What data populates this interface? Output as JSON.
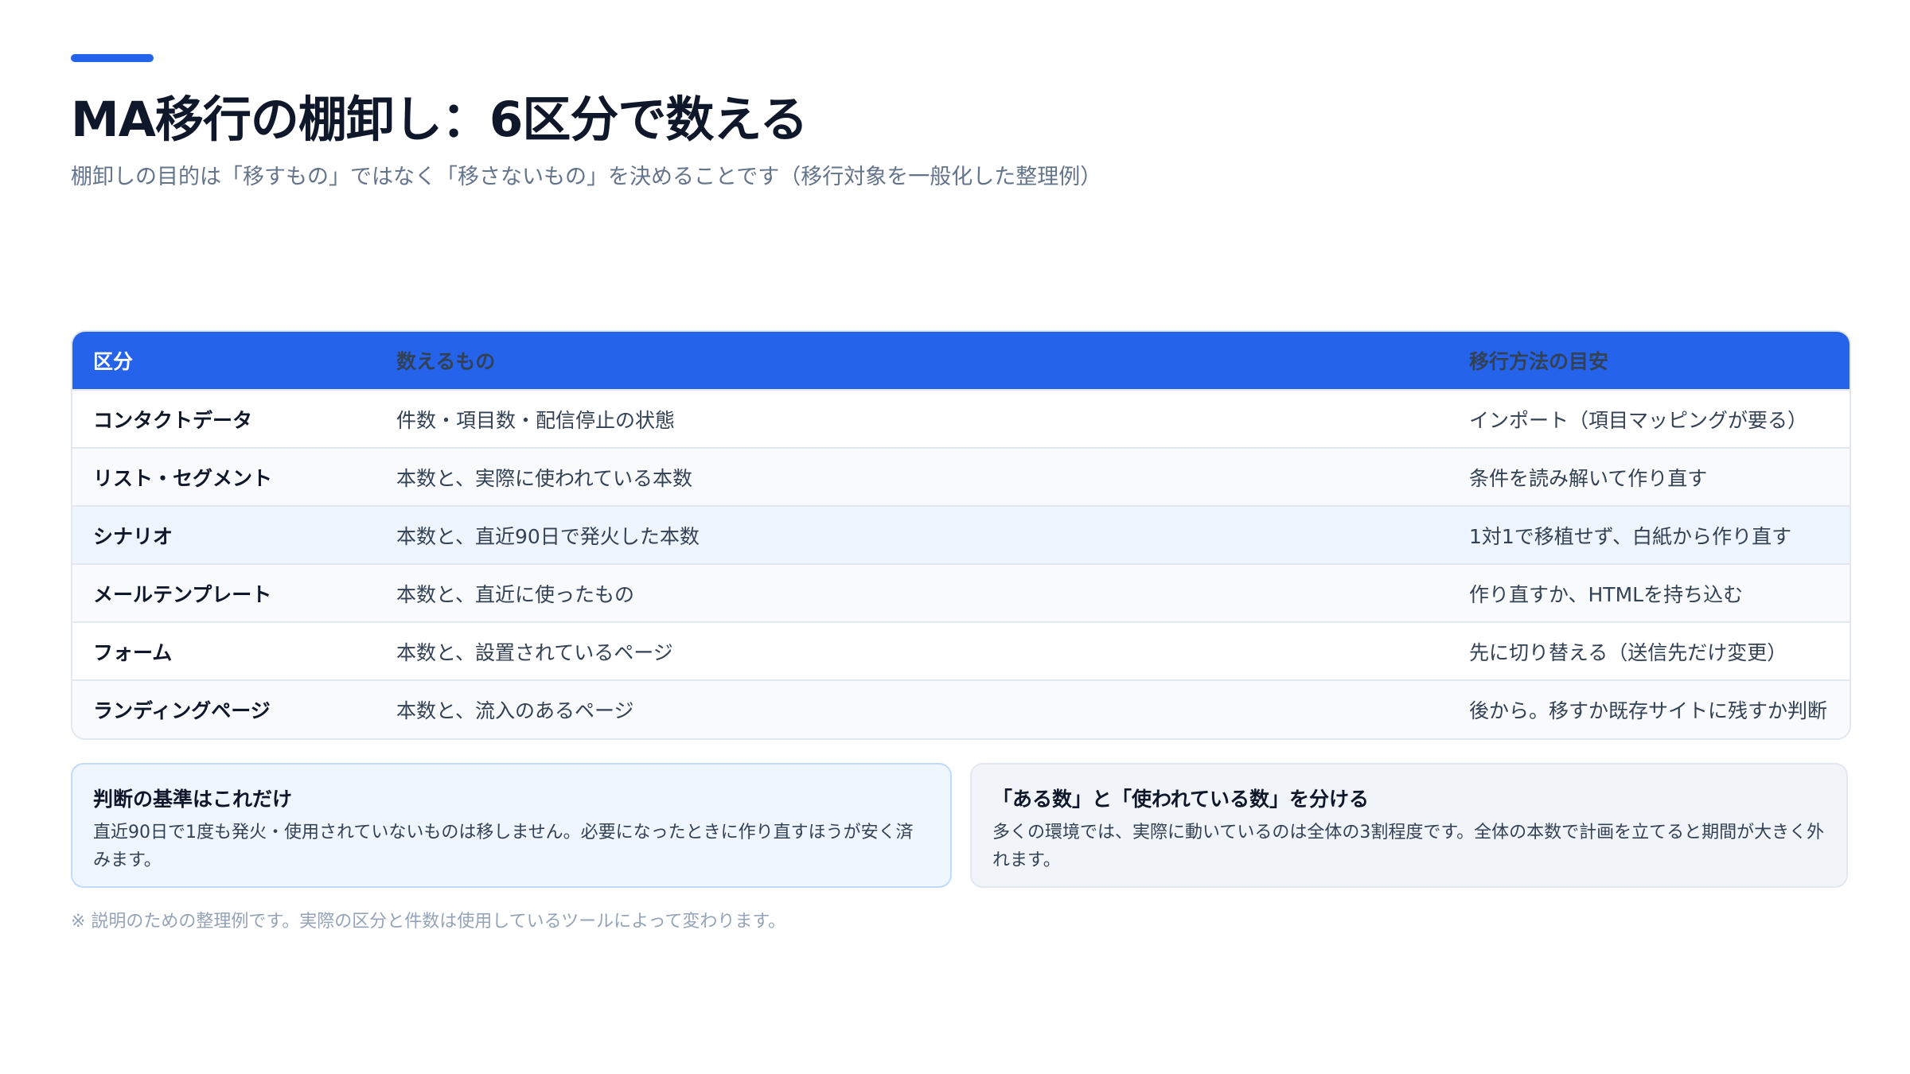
{
  "header": {
    "title": "MA移行の棚卸し：6区分で数える",
    "subtitle": "棚卸しの目的は「移すもの」ではなく「移さないもの」を決めることです（移行対象を一般化した整理例）"
  },
  "table": {
    "columns": [
      "区分",
      "数えるもの",
      "移行方法の目安"
    ],
    "rows": [
      {
        "category": "コンタクトデータ",
        "count": "件数・項目数・配信停止の状態",
        "method": "インポート（項目マッピングが要る）"
      },
      {
        "category": "リスト・セグメント",
        "count": "本数と、実際に使われている本数",
        "method": "条件を読み解いて作り直す"
      },
      {
        "category": "シナリオ",
        "count": "本数と、直近90日で発火した本数",
        "method": "1対1で移植せず、白紙から作り直す"
      },
      {
        "category": "メールテンプレート",
        "count": "本数と、直近に使ったもの",
        "method": "作り直すか、HTMLを持ち込む"
      },
      {
        "category": "フォーム",
        "count": "本数と、設置されているページ",
        "method": "先に切り替える（送信先だけ変更）"
      },
      {
        "category": "ランディングページ",
        "count": "本数と、流入のあるページ",
        "method": "後から。移すか既存サイトに残すか判断"
      }
    ]
  },
  "notes": [
    {
      "title": "判断の基準はこれだけ",
      "body": "直近90日で1度も発火・使用されていないものは移しません。必要になったときに作り直すほうが安く済みます。"
    },
    {
      "title": "「ある数」と「使われている数」を分ける",
      "body": "多くの環境では、実際に動いているのは全体の3割程度です。全体の本数で計画を立てると期間が大きく外れます。"
    }
  ],
  "footnote": "※ 説明のための整理例です。実際の区分と件数は使用しているツールによって変わります。",
  "colors": {
    "accent": "#2563eb",
    "title": "#0f172a",
    "subtitle": "#64748b",
    "footnote": "#94a3b8"
  }
}
